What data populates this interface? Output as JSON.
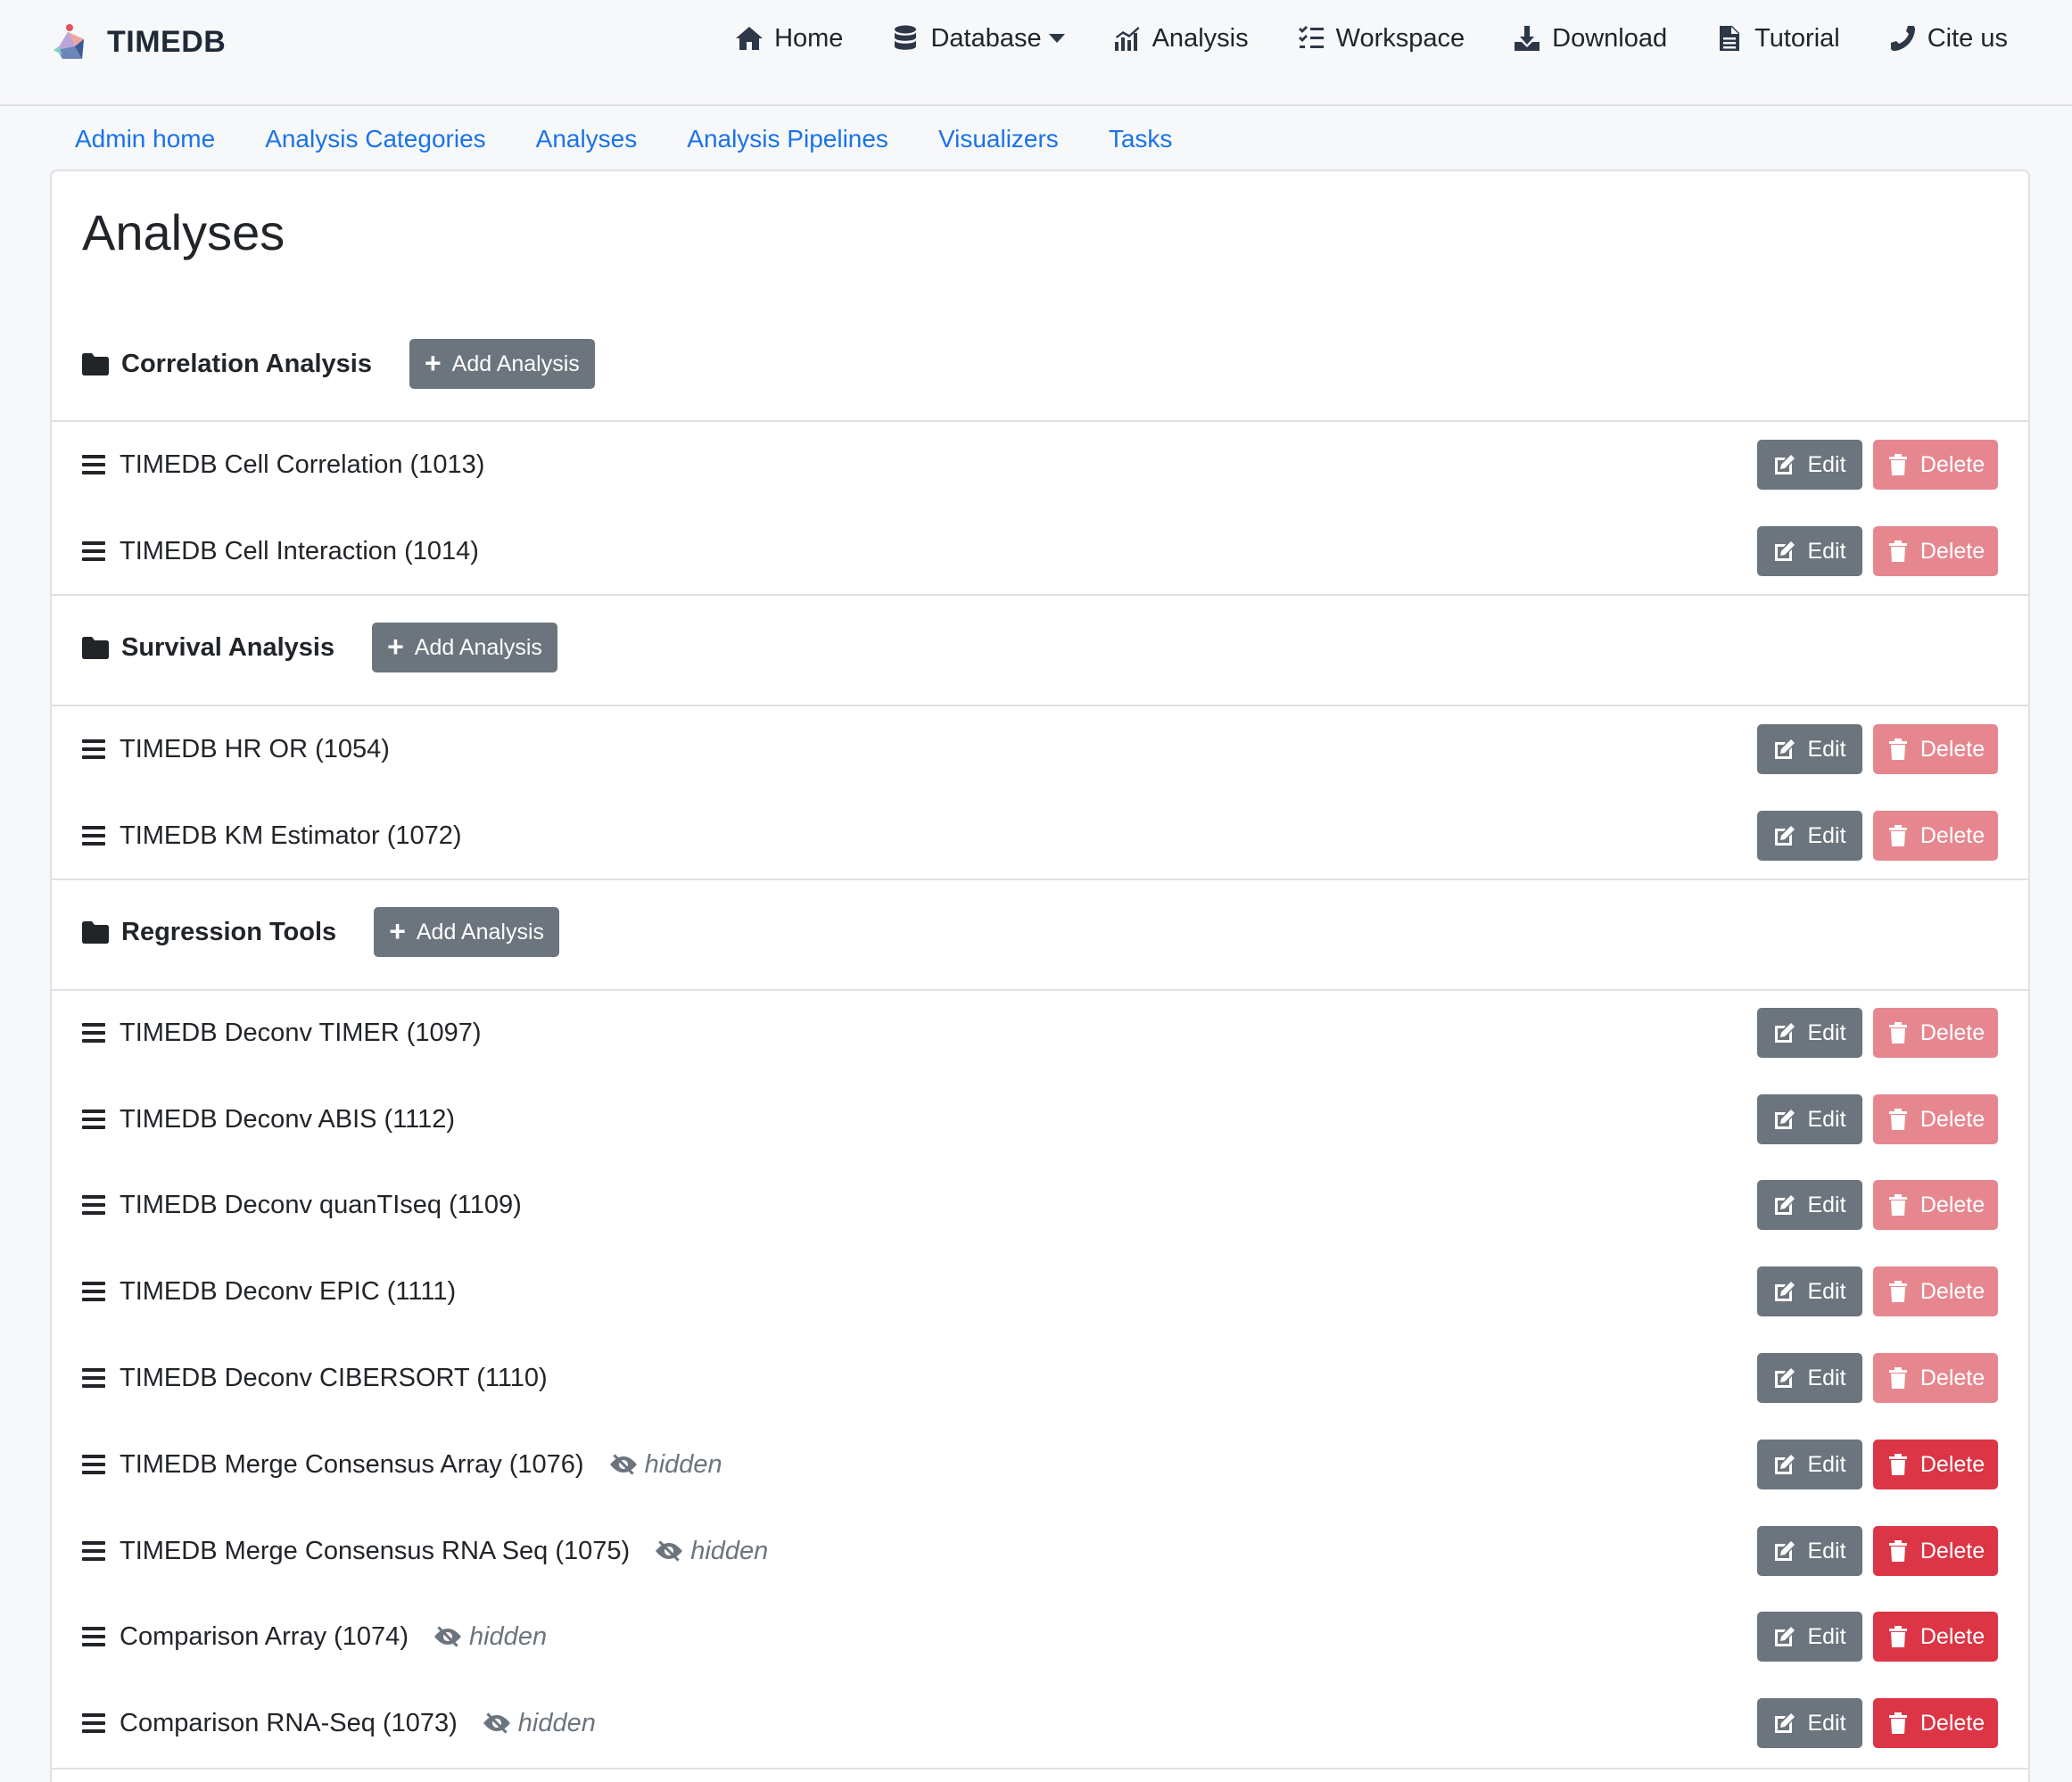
{
  "brand": {
    "name": "TIMEDB"
  },
  "nav": [
    {
      "label": "Home",
      "icon": "home-icon"
    },
    {
      "label": "Database",
      "icon": "database-icon",
      "dropdown": true
    },
    {
      "label": "Analysis",
      "icon": "chart-icon"
    },
    {
      "label": "Workspace",
      "icon": "list-check-icon"
    },
    {
      "label": "Download",
      "icon": "download-icon"
    },
    {
      "label": "Tutorial",
      "icon": "document-icon"
    },
    {
      "label": "Cite us",
      "icon": "phone-icon"
    }
  ],
  "subnav": [
    "Admin home",
    "Analysis Categories",
    "Analyses",
    "Analysis Pipelines",
    "Visualizers",
    "Tasks"
  ],
  "page": {
    "title": "Analyses"
  },
  "labels": {
    "add": "Add Analysis",
    "edit": "Edit",
    "delete": "Delete",
    "hidden": "hidden"
  },
  "colors": {
    "link": "#1a73e8",
    "secondary": "#6c757d",
    "danger": "#dc3545",
    "danger_disabled": "#e6878f"
  },
  "categories": [
    {
      "name": "Correlation Analysis",
      "analyses": [
        {
          "name": "TIMEDB Cell Correlation (1013)",
          "hidden": false,
          "delete_enabled": false
        },
        {
          "name": "TIMEDB Cell Interaction (1014)",
          "hidden": false,
          "delete_enabled": false
        }
      ]
    },
    {
      "name": "Survival Analysis",
      "analyses": [
        {
          "name": "TIMEDB HR OR (1054)",
          "hidden": false,
          "delete_enabled": false
        },
        {
          "name": "TIMEDB KM Estimator (1072)",
          "hidden": false,
          "delete_enabled": false
        }
      ]
    },
    {
      "name": "Regression Tools",
      "analyses": [
        {
          "name": "TIMEDB Deconv TIMER (1097)",
          "hidden": false,
          "delete_enabled": false
        },
        {
          "name": "TIMEDB Deconv ABIS (1112)",
          "hidden": false,
          "delete_enabled": false
        },
        {
          "name": "TIMEDB Deconv quanTIseq (1109)",
          "hidden": false,
          "delete_enabled": false
        },
        {
          "name": "TIMEDB Deconv EPIC (1111)",
          "hidden": false,
          "delete_enabled": false
        },
        {
          "name": "TIMEDB Deconv CIBERSORT (1110)",
          "hidden": false,
          "delete_enabled": false
        },
        {
          "name": "TIMEDB Merge Consensus Array (1076)",
          "hidden": true,
          "delete_enabled": true
        },
        {
          "name": "TIMEDB Merge Consensus RNA Seq (1075)",
          "hidden": true,
          "delete_enabled": true
        },
        {
          "name": "Comparison Array (1074)",
          "hidden": true,
          "delete_enabled": true
        },
        {
          "name": "Comparison RNA-Seq (1073)",
          "hidden": true,
          "delete_enabled": true
        }
      ]
    }
  ]
}
